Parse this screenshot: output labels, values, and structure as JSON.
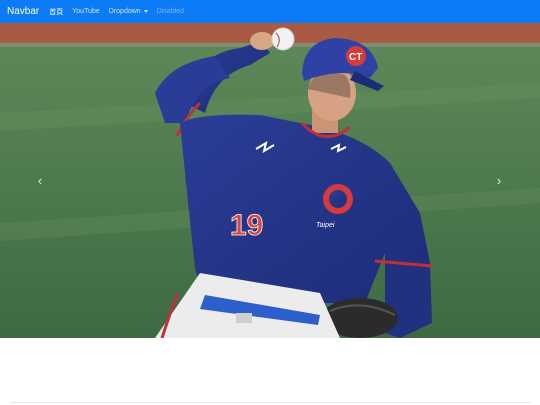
{
  "navbar": {
    "brand": "Navbar",
    "links": [
      {
        "label": "首頁",
        "state": "active"
      },
      {
        "label": "YouTube",
        "state": "normal"
      },
      {
        "label": "Dropdown",
        "state": "dropdown"
      },
      {
        "label": "Disabled",
        "state": "disabled"
      }
    ],
    "background": "#0b7cf5"
  },
  "carousel": {
    "slide": {
      "jersey_number": "19",
      "jersey_text": "Taipei",
      "cap_logo": "CT"
    },
    "prev_icon": "chevron-left-icon",
    "next_icon": "chevron-right-icon"
  }
}
